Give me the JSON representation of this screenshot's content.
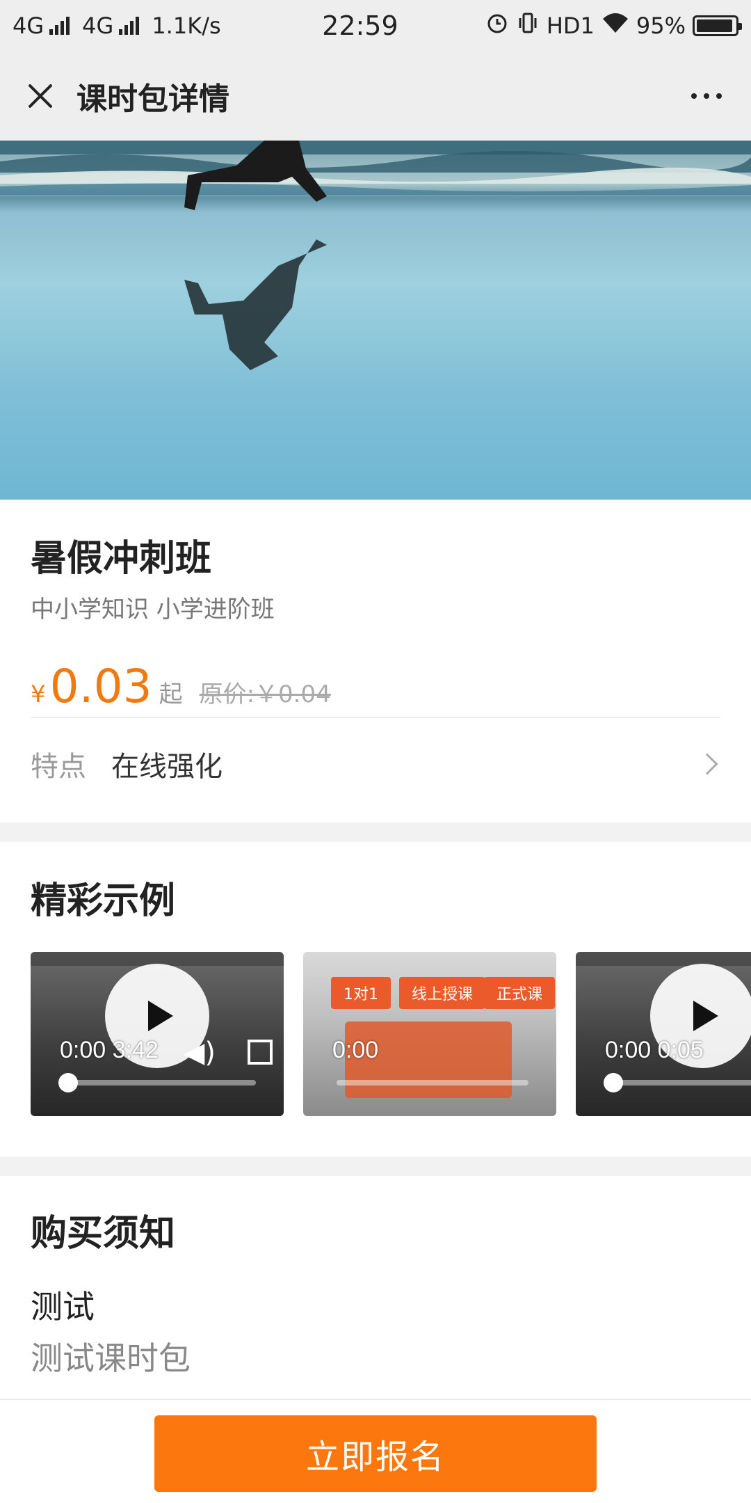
{
  "status_bar": {
    "network1": "4G",
    "network2": "4G",
    "speed": "1.1K/s",
    "time": "22:59",
    "hd": "HD1",
    "battery": "95%",
    "battery_level": 0.95
  },
  "nav": {
    "title": "课时包详情",
    "close_icon": "close-icon",
    "more_icon": "more-icon"
  },
  "course": {
    "title": "暑假冲刺班",
    "subtitle": "中小学知识 小学进阶班",
    "price_symbol": "¥",
    "price": "0.03",
    "price_suffix": "起",
    "original_price": "原价:￥0.04",
    "feature_label": "特点",
    "feature_value": "在线强化"
  },
  "examples": {
    "title": "精彩示例",
    "videos": [
      {
        "time": "0:00 3:42",
        "progress": 0.0
      },
      {
        "time": "0:00",
        "progress": 0.0,
        "promo": [
          "1对1",
          "线上授课",
          "正式课"
        ]
      },
      {
        "time": "0:00 0:05",
        "progress": 0.0
      }
    ]
  },
  "notice": {
    "title": "购买须知",
    "item_title": "测试",
    "item_text": "测试课时包"
  },
  "cta": {
    "label": "立即报名"
  },
  "colors": {
    "accent": "#fd770f",
    "price": "#f07a12"
  }
}
